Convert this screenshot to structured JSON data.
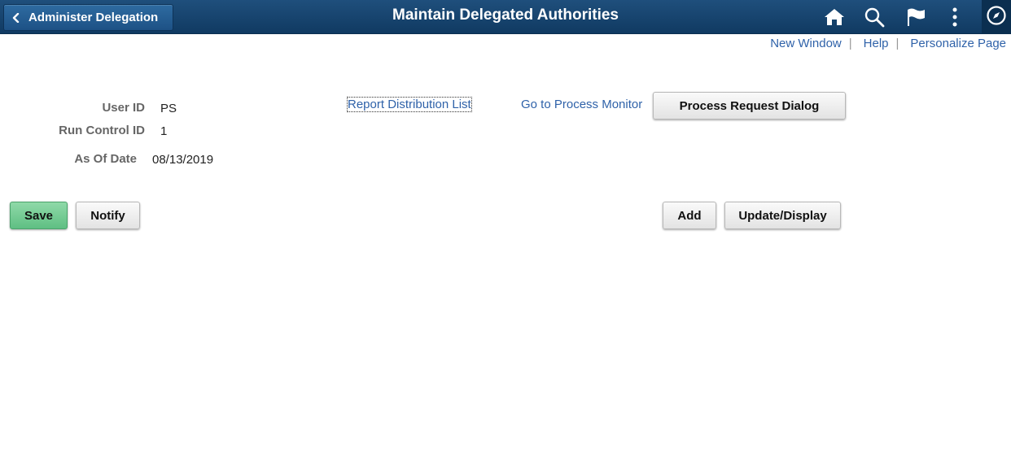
{
  "header": {
    "back_button_label": "Administer Delegation",
    "title": "Maintain Delegated Authorities",
    "icons": [
      "home-icon",
      "search-icon",
      "flag-icon",
      "more-options-icon",
      "navbar-compass-icon"
    ]
  },
  "toplinks": {
    "new_window": "New Window",
    "help": "Help",
    "personalize": "Personalize Page",
    "separator": "|"
  },
  "form": {
    "user_id_label": "User ID",
    "user_id_value": "PS",
    "run_control_label": "Run Control ID",
    "run_control_value": "1",
    "as_of_date_label": "As Of Date",
    "as_of_date_value": "08/13/2019"
  },
  "links": {
    "report_distribution": "Report Distribution List",
    "process_monitor": "Go to Process Monitor"
  },
  "buttons": {
    "process_request": "Process Request Dialog",
    "save": "Save",
    "notify": "Notify",
    "add": "Add",
    "update_display": "Update/Display"
  },
  "colors": {
    "banner": "#1f4f7c",
    "link": "#2f62a9",
    "save_button": "#6fcb91"
  }
}
